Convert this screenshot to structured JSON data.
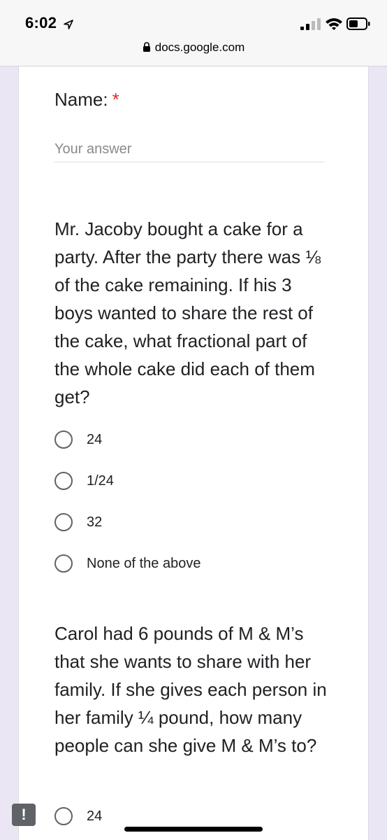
{
  "status_bar": {
    "time": "6:02"
  },
  "browser": {
    "url": "docs.google.com"
  },
  "form": {
    "name_question": {
      "title": "Name:",
      "required_mark": "*",
      "placeholder": "Your answer"
    },
    "question_2": {
      "text": "Mr. Jacoby bought a cake for a party. After the party there was ⅛ of the cake remaining. If his 3 boys wanted to share the rest of the cake, what fractional part of the whole cake did each of them get?",
      "options": [
        "24",
        "1/24",
        "32",
        "None of the above"
      ]
    },
    "question_3": {
      "text": "Carol had 6 pounds of M & M’s that she wants to share with her family. If she gives each person in her family ¼ pound, how many people can she give M & M’s to?",
      "options": [
        "24"
      ]
    }
  },
  "feedback_button": {
    "label": "!"
  }
}
